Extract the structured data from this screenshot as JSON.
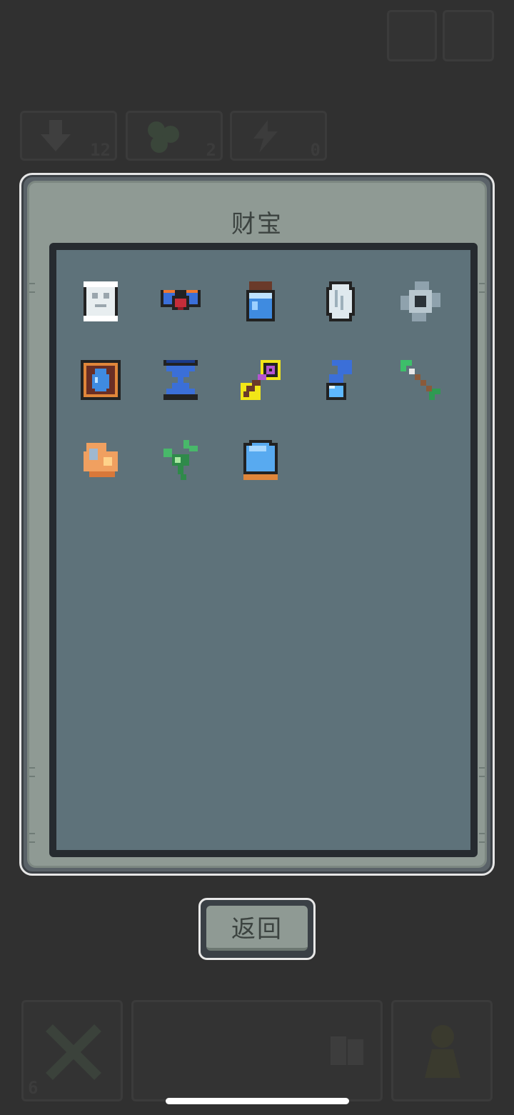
{
  "hud": {
    "top_buttons": [
      {
        "name": "menu-button-1"
      },
      {
        "name": "menu-button-2"
      }
    ],
    "counters": [
      {
        "icon": "arrow-down-icon",
        "value": "12"
      },
      {
        "icon": "clover-icon",
        "value": "2"
      },
      {
        "icon": "lightning-icon",
        "value": "0"
      }
    ],
    "bottom_left_counter": "6"
  },
  "dialog": {
    "title": "财宝",
    "items": [
      {
        "icon": "scroll-icon"
      },
      {
        "icon": "winged-gem-icon"
      },
      {
        "icon": "potion-jar-icon"
      },
      {
        "icon": "mirror-icon"
      },
      {
        "icon": "gear-shuriken-icon"
      },
      {
        "icon": "water-tome-icon"
      },
      {
        "icon": "hourglass-icon"
      },
      {
        "icon": "magic-key-icon",
        "selected": true
      },
      {
        "icon": "blue-flask-icon"
      },
      {
        "icon": "green-arrow-icon"
      },
      {
        "icon": "orange-shell-icon"
      },
      {
        "icon": "green-sprout-icon"
      },
      {
        "icon": "crystal-ball-icon"
      }
    ]
  },
  "back_button": {
    "label": "返回"
  },
  "colors": {
    "background": "#303030",
    "panel": "#8f9a94",
    "content": "#5e727a",
    "selection": "#f2e617"
  }
}
